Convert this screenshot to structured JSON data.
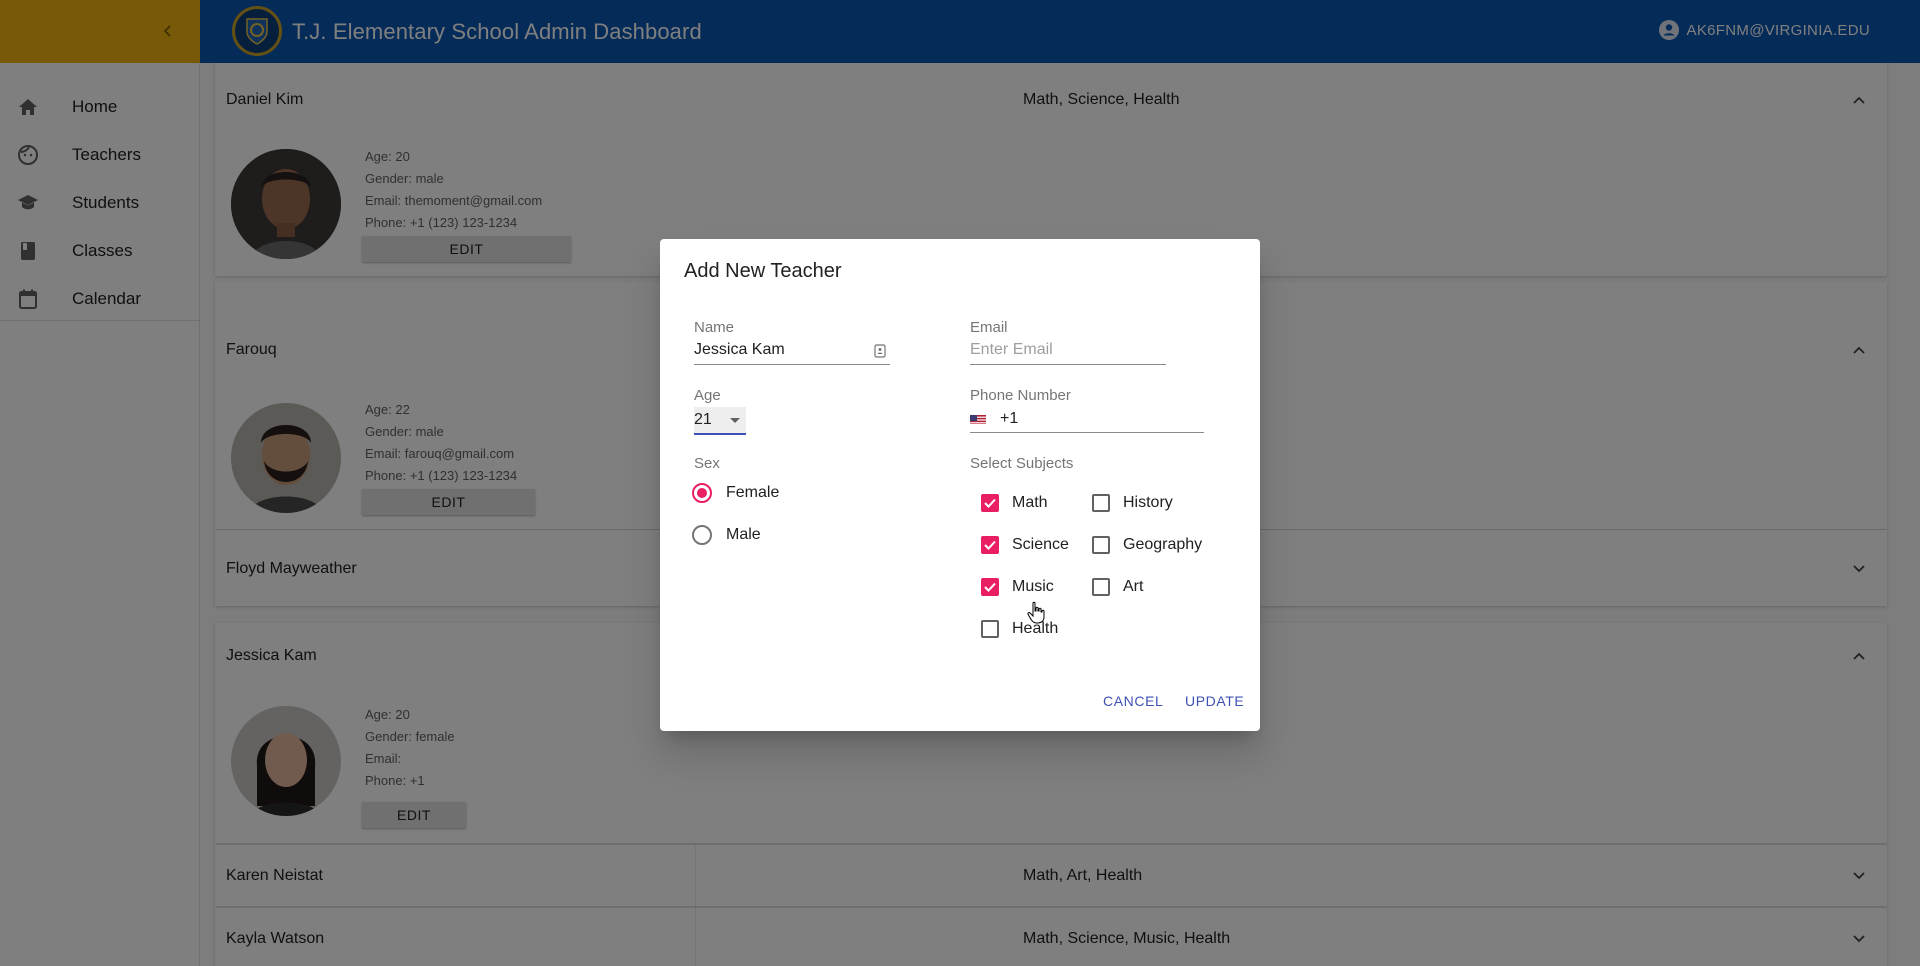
{
  "app": {
    "title": "T.J. Elementary School Admin Dashboard",
    "user_email": "AK6FNM@VIRGINIA.EDU"
  },
  "sidebar": {
    "items": [
      {
        "label": "Home",
        "icon": "home-icon"
      },
      {
        "label": "Teachers",
        "icon": "face-icon"
      },
      {
        "label": "Students",
        "icon": "school-icon"
      },
      {
        "label": "Classes",
        "icon": "book-icon"
      },
      {
        "label": "Calendar",
        "icon": "calendar-icon"
      }
    ]
  },
  "teachers": [
    {
      "name": "Daniel Kim",
      "subjects": "Math, Science, Health",
      "age": "Age: 20",
      "gender": "Gender: male",
      "email": "Email: themoment@gmail.com",
      "phone": "Phone: +1 (123) 123-1234",
      "edit": "EDIT"
    },
    {
      "name": "Farouq",
      "subjects": "",
      "age": "Age: 22",
      "gender": "Gender: male",
      "email": "Email: farouq@gmail.com",
      "phone": "Phone: +1 (123) 123-1234",
      "edit": "EDIT"
    },
    {
      "name": "Floyd Mayweather",
      "subjects": ""
    },
    {
      "name": "Jessica Kam",
      "subjects": "",
      "age": "Age: 20",
      "gender": "Gender: female",
      "email": "Email:",
      "phone": "Phone: +1",
      "edit": "EDIT"
    },
    {
      "name": "Karen Neistat",
      "subjects": "Math, Art, Health"
    },
    {
      "name": "Kayla Watson",
      "subjects": "Math, Science, Music, Health"
    }
  ],
  "dialog": {
    "title": "Add New Teacher",
    "name_label": "Name",
    "name_value": "Jessica Kam",
    "email_label": "Email",
    "email_placeholder": "Enter Email",
    "age_label": "Age",
    "age_value": "21",
    "phone_label": "Phone Number",
    "phone_value": "+1",
    "sex_label": "Sex",
    "sex_options": [
      {
        "label": "Female",
        "selected": true
      },
      {
        "label": "Male",
        "selected": false
      }
    ],
    "subjects_label": "Select Subjects",
    "subjects": [
      {
        "label": "Math",
        "checked": true
      },
      {
        "label": "History",
        "checked": false
      },
      {
        "label": "Science",
        "checked": true
      },
      {
        "label": "Geography",
        "checked": false
      },
      {
        "label": "Music",
        "checked": true
      },
      {
        "label": "Art",
        "checked": false
      },
      {
        "label": "Health",
        "checked": false
      }
    ],
    "cancel_label": "CANCEL",
    "update_label": "UPDATE"
  },
  "colors": {
    "appbar": "#0a56b3",
    "appbar_left": "#f1b20f",
    "accent": "#e91e63",
    "button_text": "#3f51b5"
  }
}
